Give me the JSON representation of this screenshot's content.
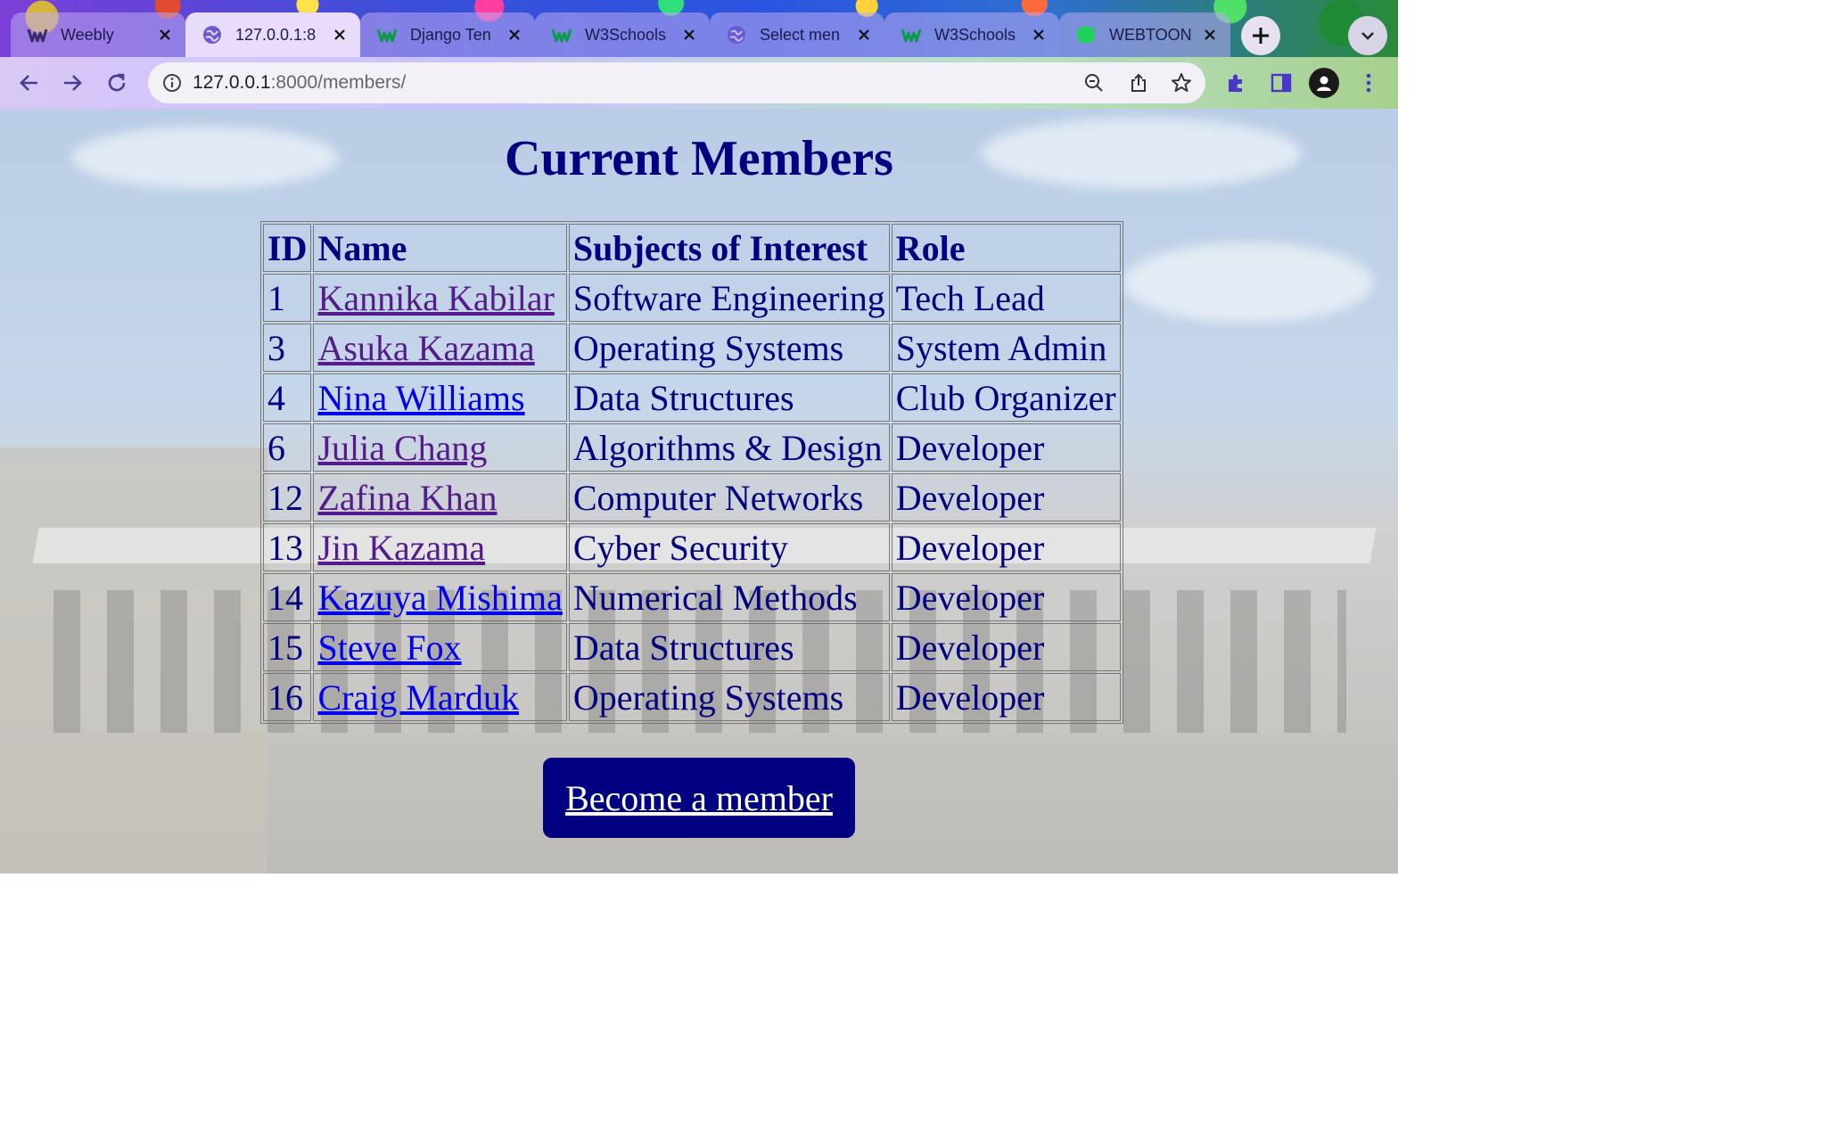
{
  "browser": {
    "tabs": [
      {
        "title": "Weebly",
        "icon": "weebly-icon",
        "active": false
      },
      {
        "title": "127.0.0.1:8",
        "icon": "globe-icon",
        "active": true
      },
      {
        "title": "Django Ten",
        "icon": "w3schools-icon",
        "active": false
      },
      {
        "title": "W3Schools",
        "icon": "w3schools-icon",
        "active": false
      },
      {
        "title": "Select men",
        "icon": "globe-icon",
        "active": false
      },
      {
        "title": "W3Schools",
        "icon": "w3schools-icon",
        "active": false
      },
      {
        "title": "WEBTOON",
        "icon": "webtoon-icon",
        "active": false
      }
    ],
    "url_host": "127.0.0.1",
    "url_path": ":8000/members/"
  },
  "page": {
    "title": "Current Members",
    "columns": [
      "ID",
      "Name",
      "Subjects of Interest",
      "Role"
    ],
    "rows": [
      {
        "id": "1",
        "name": "Kannika Kabilar",
        "subject": "Software Engineering",
        "role": "Tech Lead",
        "visited": true
      },
      {
        "id": "3",
        "name": "Asuka Kazama",
        "subject": "Operating Systems",
        "role": "System Admin",
        "visited": true
      },
      {
        "id": "4",
        "name": "Nina Williams",
        "subject": "Data Structures",
        "role": "Club Organizer",
        "visited": false
      },
      {
        "id": "6",
        "name": "Julia Chang",
        "subject": "Algorithms & Design",
        "role": "Developer",
        "visited": true
      },
      {
        "id": "12",
        "name": "Zafina Khan",
        "subject": "Computer Networks",
        "role": "Developer",
        "visited": true
      },
      {
        "id": "13",
        "name": "Jin Kazama",
        "subject": "Cyber Security",
        "role": "Developer",
        "visited": true
      },
      {
        "id": "14",
        "name": "Kazuya Mishima",
        "subject": "Numerical Methods",
        "role": "Developer",
        "visited": false
      },
      {
        "id": "15",
        "name": "Steve Fox",
        "subject": "Data Structures",
        "role": "Developer",
        "visited": false
      },
      {
        "id": "16",
        "name": "Craig Marduk",
        "subject": "Operating Systems",
        "role": "Developer",
        "visited": false
      }
    ],
    "join_button": "Become a member"
  },
  "colors": {
    "heading": "#000080",
    "link": "#0000ee",
    "link_visited": "#551a8b",
    "button_bg": "#000080"
  }
}
